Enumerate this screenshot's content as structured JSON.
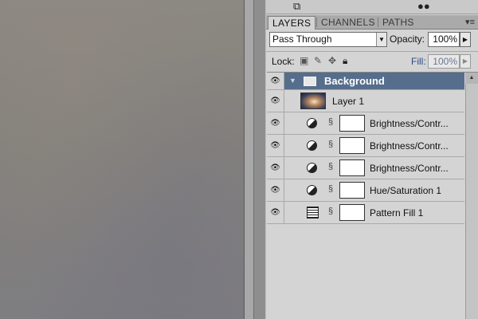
{
  "toolbar_icons": [
    "resize-icon",
    "channels-dock-icon"
  ],
  "tabs": [
    {
      "label": "LAYERS",
      "active": true
    },
    {
      "label": "CHANNELS",
      "active": false
    },
    {
      "label": "PATHS",
      "active": false
    }
  ],
  "panel_menu_glyph": "▾≡",
  "blend_mode": "Pass Through",
  "opacity": {
    "label": "Opacity:",
    "value": "100%"
  },
  "lock": {
    "label": "Lock:"
  },
  "fill": {
    "label": "Fill:",
    "value": "100%"
  },
  "group": {
    "name": "Background",
    "visible": true,
    "expanded": true
  },
  "layers": [
    {
      "name": "Layer 1",
      "type": "pixel",
      "visible": true
    },
    {
      "name": "Brightness/Contr...",
      "type": "adjustment",
      "visible": true
    },
    {
      "name": "Brightness/Contr...",
      "type": "adjustment",
      "visible": true
    },
    {
      "name": "Brightness/Contr...",
      "type": "adjustment",
      "visible": true
    },
    {
      "name": "Hue/Saturation 1",
      "type": "adjustment",
      "visible": true
    },
    {
      "name": "Pattern Fill 1",
      "type": "pattern-fill",
      "visible": true
    }
  ],
  "colors": {
    "selected_group": "#566e8c",
    "fill_label": "#2a4c8a"
  }
}
